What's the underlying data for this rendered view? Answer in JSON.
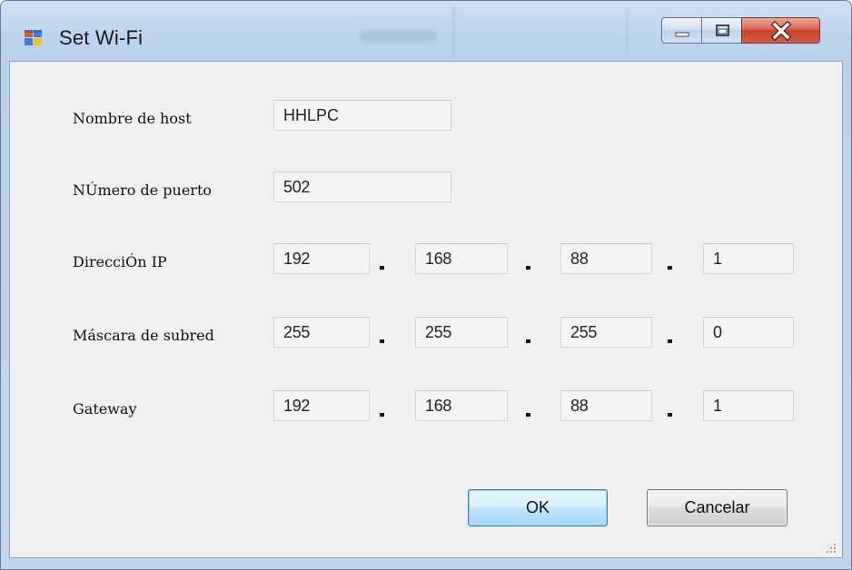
{
  "window": {
    "title": "Set Wi-Fi",
    "icon": "app-window-icon",
    "controls": [
      "minimize-icon",
      "maximize-icon",
      "close-icon"
    ]
  },
  "form": {
    "hostname": {
      "label": "Nombre de host",
      "value": "HHLPC"
    },
    "port": {
      "label": "NÚmero de puerto",
      "value": "502"
    },
    "ip": {
      "label": "DirecciÓn IP",
      "octets": [
        "192",
        "168",
        "88",
        "1"
      ]
    },
    "mask": {
      "label": "Máscara de subred",
      "octets": [
        "255",
        "255",
        "255",
        "0"
      ]
    },
    "gateway": {
      "label": "Gateway",
      "octets": [
        "192",
        "168",
        "88",
        "1"
      ]
    }
  },
  "buttons": {
    "ok": "OK",
    "cancel": "Cancelar"
  }
}
